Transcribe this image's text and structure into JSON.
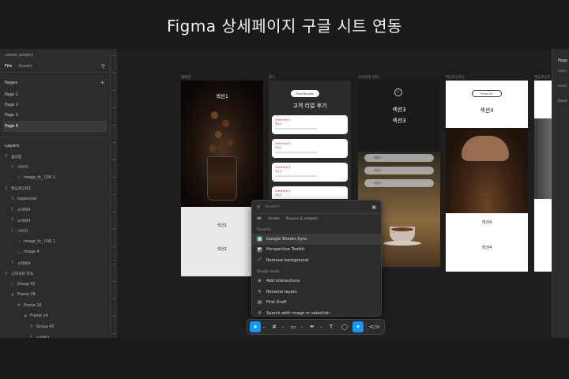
{
  "headline": "Figma 상세페이지 구글 시트 연동",
  "left_panel": {
    "project_name": "coloso_project",
    "tabs": [
      "File",
      "Assets"
    ],
    "pages_title": "Pages",
    "pages": [
      "Page 1",
      "Page 2",
      "Page 3",
      "Page 4"
    ],
    "layers_title": "Layers",
    "layers": [
      {
        "label": "썸네일",
        "glyph": "⠿",
        "indent": 0
      },
      {
        "label": "이미지",
        "glyph": "⠿",
        "indent": 1
      },
      {
        "label": "image_fx_ (34) 1",
        "glyph": "▭",
        "indent": 2
      },
      {
        "label": "핵심포인트1",
        "glyph": "⠿",
        "indent": 0
      },
      {
        "label": "topbanner",
        "glyph": "⠿",
        "indent": 1
      },
      {
        "label": "소제목4",
        "glyph": "T",
        "indent": 1
      },
      {
        "label": "소제목4",
        "glyph": "T",
        "indent": 1
      },
      {
        "label": "이미지",
        "glyph": "⠿",
        "indent": 1
      },
      {
        "label": "image_fx_ (38) 1",
        "glyph": "▭",
        "indent": 2
      },
      {
        "label": "image 4",
        "glyph": "▭",
        "indent": 2
      },
      {
        "label": "소제목4",
        "glyph": "T",
        "indent": 1
      },
      {
        "label": "고객과의 약속",
        "glyph": "⠿",
        "indent": 0
      },
      {
        "label": "Group 43",
        "glyph": "⠿",
        "indent": 1
      },
      {
        "label": "Frame 28",
        "glyph": "#",
        "indent": 1
      },
      {
        "label": "Frame 16",
        "glyph": "#",
        "indent": 2
      },
      {
        "label": "Frame 14",
        "glyph": "#",
        "indent": 3
      },
      {
        "label": "Group 43",
        "glyph": "⠿",
        "indent": 4
      },
      {
        "label": "소제목3",
        "glyph": "T",
        "indent": 4
      }
    ]
  },
  "canvas": {
    "frame_labels": [
      "썸네일",
      "후기",
      "고객과의 약속",
      "핵심포인트1",
      "핵심포인트2"
    ],
    "thumbnail": {
      "section": "섹션1",
      "sub1": "섹션1",
      "sub2": "섹션1"
    },
    "review": {
      "pill": "Real Review",
      "title": "고객 리얼 후기",
      "stars": "★★★★★ 5",
      "card_text": "좋아요"
    },
    "promise": {
      "check": "✓",
      "s1": "섹션3",
      "s2": "섹션3",
      "chips": [
        "섹션3",
        "섹션3",
        "섹션3"
      ]
    },
    "point": {
      "pill": "Point 01",
      "title": "섹션4",
      "sub1": "섹션4",
      "sub2": "섹션4"
    }
  },
  "quick_actions": {
    "search_placeholder": "Search",
    "tabs": [
      "All",
      "Assets",
      "Plugins & widgets"
    ],
    "recents_title": "Recents",
    "recents": [
      {
        "label": "Google Sheets Sync",
        "icon": "sheets-icon"
      },
      {
        "label": "Perspective Toolkit",
        "icon": "perspective-icon"
      },
      {
        "label": "Remove background",
        "icon": "remove-bg-icon"
      }
    ],
    "design_tools_title": "Design tools",
    "design_tools": [
      {
        "label": "Add interactions",
        "icon": "interactions-icon"
      },
      {
        "label": "Rename layers",
        "icon": "rename-icon"
      },
      {
        "label": "First Draft",
        "icon": "draft-icon"
      },
      {
        "label": "Search with image or selection",
        "icon": "image-search-icon"
      }
    ]
  },
  "toolbar": {
    "tools": [
      "move-tool-icon",
      "frame-tool-icon",
      "shape-tool-icon",
      "pen-tool-icon",
      "text-tool-icon",
      "comment-tool-icon",
      "actions-tool-icon",
      "dev-mode-icon"
    ],
    "active_color": "#0d99ff"
  },
  "right_panel": {
    "title": "Page",
    "items": [
      "Local",
      "Local",
      "Expor"
    ]
  }
}
